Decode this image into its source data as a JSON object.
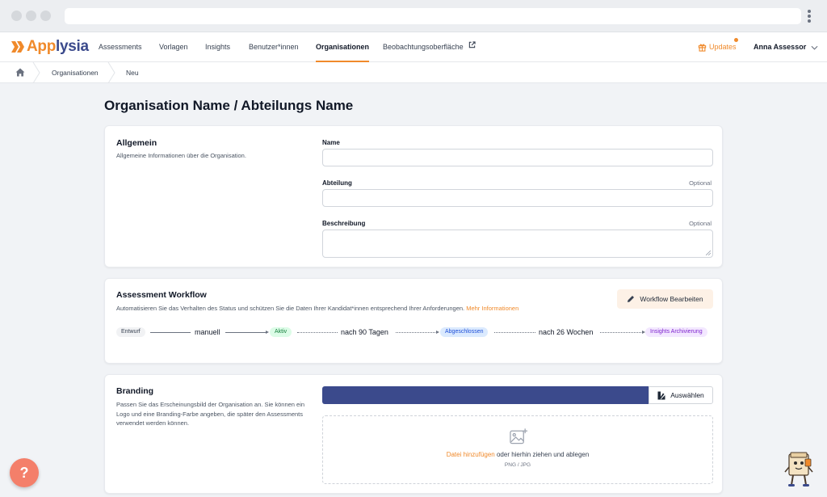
{
  "brand": {
    "name_part1": "App",
    "name_part2": "lysia",
    "accent": "#f08a2b",
    "primary": "#3b4a8c"
  },
  "nav": {
    "items": [
      {
        "label": "Assessments"
      },
      {
        "label": "Vorlagen"
      },
      {
        "label": "Insights"
      },
      {
        "label": "Benutzer*innen"
      },
      {
        "label": "Organisationen",
        "active": true
      },
      {
        "label": "Beobachtungsoberfläche",
        "icon": "external-link-icon"
      }
    ],
    "updates_label": "Updates",
    "user_name": "Anna Assessor"
  },
  "breadcrumb": {
    "home_icon": "home-icon",
    "items": [
      "Organisationen",
      "Neu"
    ]
  },
  "page": {
    "title": "Organisation Name / Abteilungs Name"
  },
  "general": {
    "title": "Allgemein",
    "description": "Allgemeine Informationen über die Organisation.",
    "name_label": "Name",
    "department_label": "Abteilung",
    "department_optional": "Optional",
    "description_label": "Beschreibung",
    "description_optional": "Optional",
    "name_value": "",
    "department_value": "",
    "description_value": ""
  },
  "workflow": {
    "title": "Assessment Workflow",
    "description": "Automatisieren Sie das Verhalten des Status und schützen Sie die Daten Ihrer Kandidat*innen entsprechend Ihrer Anforderungen.",
    "more_link": "Mehr Informationen",
    "edit_button": "Workflow Bearbeiten",
    "steps": {
      "draft": "Entwurf",
      "manual": "manuell",
      "active": "Aktiv",
      "after_90": "nach 90 Tagen",
      "completed": "Abgeschlossen",
      "after_26": "nach 26 Wochen",
      "archived": "Insights Archivierung"
    },
    "colors": {
      "draft_bg": "#f1f2f4",
      "active_bg": "#dcfce7",
      "active_fg": "#15803d",
      "completed_bg": "#dbeafe",
      "completed_fg": "#1d4ed8",
      "archived_bg": "#f3e8ff",
      "archived_fg": "#7e22ce"
    }
  },
  "branding": {
    "title": "Branding",
    "description": "Passen Sie das Erscheinungsbild der Organisation an. Sie können ein Logo und eine Branding-Farbe angeben, die später den Assessments verwendet werden können.",
    "color": "#3b4a8c",
    "choose_button": "Auswählen",
    "add_file": "Datei hinzufügen",
    "drop_text": " oder hierhin ziehen und ablegen",
    "formats": "PNG / JPG"
  },
  "help_label": "?"
}
